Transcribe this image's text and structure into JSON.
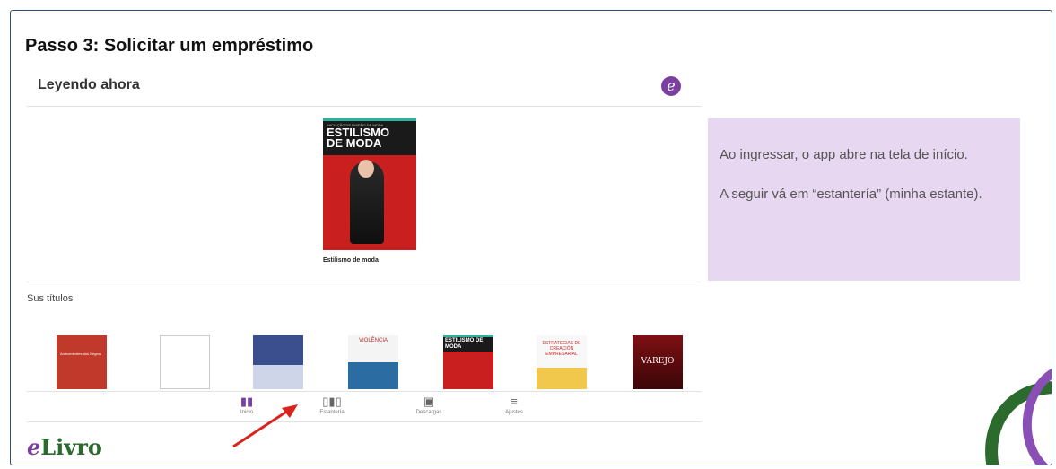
{
  "slide": {
    "title": "Passo 3: Solicitar um empréstimo"
  },
  "app": {
    "header_title": "Leyendo ahora",
    "logo_letter": "e",
    "featured": {
      "cover_small_text": "INICIAÇÃO DE DISEÑO DE MODA",
      "cover_title_line1": "ESTILISMO",
      "cover_title_line2": "DE MODA",
      "caption": "Estilismo de moda"
    },
    "section_label": "Sus títulos",
    "thumbnails": [
      {
        "text": "Antecedentes dos Negros"
      },
      {
        "text": ""
      },
      {
        "text": ""
      },
      {
        "text": "VIOLÊNCIA"
      },
      {
        "text": "ESTILISMO DE MODA"
      },
      {
        "text": "ESTRATEGIAS DE CREACIÓN EMPRESARIAL"
      },
      {
        "text": "VAREJO"
      }
    ],
    "nav": [
      {
        "label": "Inicio",
        "icon": "book-open-icon"
      },
      {
        "label": "Estantería",
        "icon": "bookshelf-icon"
      },
      {
        "label": "Descargas",
        "icon": "download-icon"
      },
      {
        "label": "Ajustes",
        "icon": "sliders-icon"
      }
    ]
  },
  "note": {
    "paragraph1": "Ao ingressar, o app abre na tela de início.",
    "paragraph2": "A seguir vá em “estantería” (minha estante)."
  },
  "brand": {
    "e": "e",
    "rest": "Livro"
  },
  "colors": {
    "frame_border": "#34506e",
    "note_bg": "#e8d7f1",
    "brand_green": "#2b6b2e",
    "brand_purple": "#7b3fa0",
    "arrow_red": "#d9231d"
  }
}
